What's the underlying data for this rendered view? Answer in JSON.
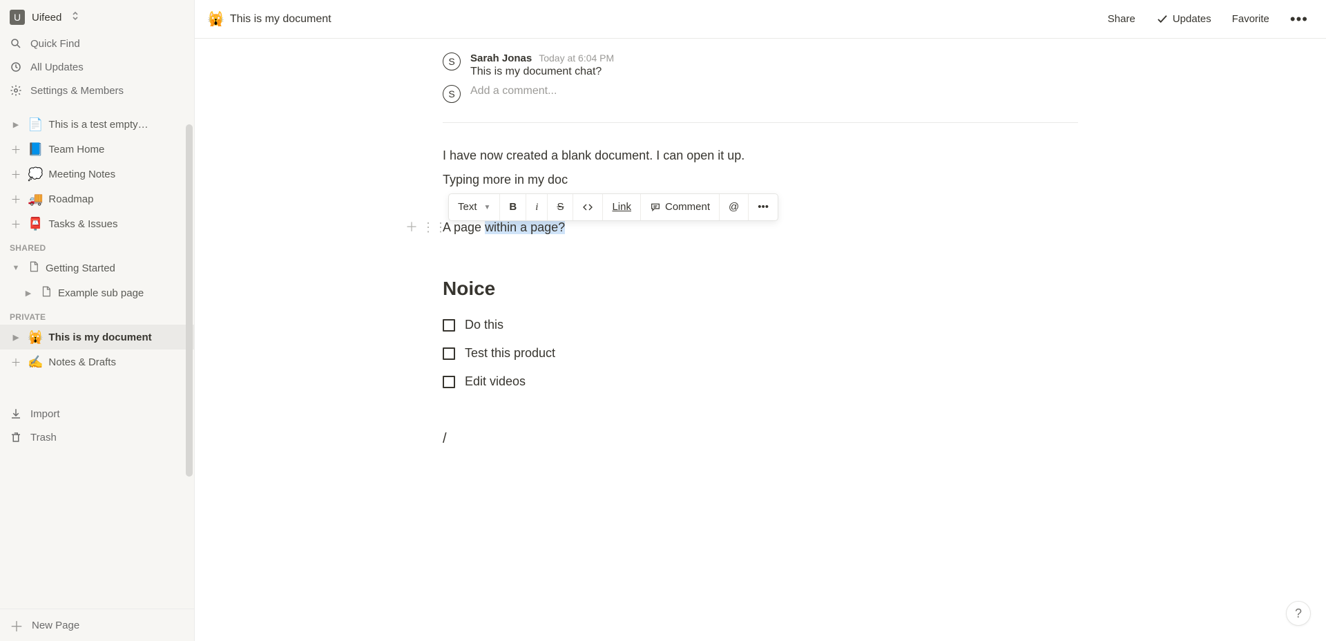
{
  "workspace": {
    "name": "Uifeed",
    "initial": "U"
  },
  "sidebar": {
    "quick_find": "Quick Find",
    "all_updates": "All Updates",
    "settings_members": "Settings & Members",
    "import": "Import",
    "trash": "Trash",
    "new_page": "New Page",
    "sections": {
      "workspace": [
        {
          "icon": "📄",
          "label": "This is a test empty…",
          "pre": "tri-right"
        },
        {
          "icon": "📘",
          "label": "Team Home",
          "pre": "plus"
        },
        {
          "icon": "💭",
          "label": "Meeting Notes",
          "pre": "plus"
        },
        {
          "icon": "🚚",
          "label": "Roadmap",
          "pre": "plus"
        },
        {
          "icon": "📮",
          "label": "Tasks & Issues",
          "pre": "plus"
        }
      ],
      "shared_header": "SHARED",
      "shared": [
        {
          "icon": "doc",
          "label": "Getting Started",
          "pre": "tri-down"
        },
        {
          "icon": "doc",
          "label": "Example sub page",
          "pre": "tri-right",
          "sub": true
        }
      ],
      "private_header": "PRIVATE",
      "private": [
        {
          "icon": "🙀",
          "label": "This is my document",
          "pre": "tri-right",
          "active": true
        },
        {
          "icon": "✍️",
          "label": "Notes & Drafts",
          "pre": "plus"
        }
      ]
    }
  },
  "header": {
    "emoji": "🙀",
    "title": "This is my document",
    "actions": {
      "share": "Share",
      "updates": "Updates",
      "favorite": "Favorite"
    }
  },
  "comments": {
    "avatar_initial": "S",
    "author": "Sarah Jonas",
    "time": "Today at 6:04 PM",
    "text": "This is my document chat?",
    "placeholder": "Add a comment..."
  },
  "document": {
    "p1": "I have now created a blank document. I can open it up.",
    "p2": "Typing more in my doc",
    "page_line_pre": "A page ",
    "page_line_hl": "within a page?",
    "heading": "Noice",
    "todos": [
      "Do this",
      "Test this product",
      "Edit videos"
    ],
    "slash": "/"
  },
  "toolbar": {
    "text": "Text",
    "bold": "B",
    "italic": "i",
    "strike": "S",
    "link": "Link",
    "comment": "Comment",
    "mention": "@",
    "more": "•••"
  }
}
